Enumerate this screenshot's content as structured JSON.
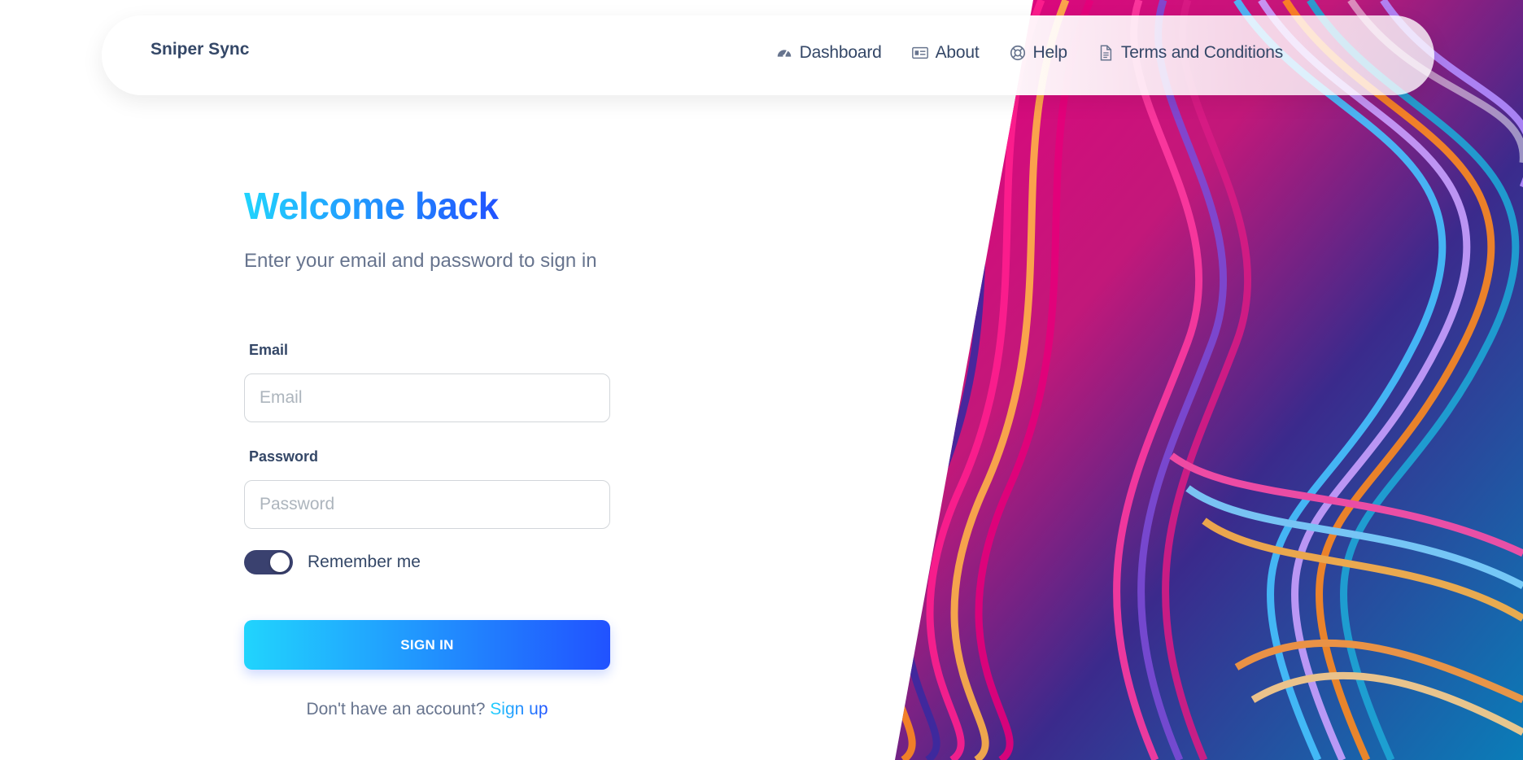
{
  "navbar": {
    "brand": "Sniper Sync",
    "items": [
      {
        "label": "Dashboard",
        "icon": "dashboard-gauge-icon"
      },
      {
        "label": "About",
        "icon": "id-card-icon"
      },
      {
        "label": "Help",
        "icon": "lifebuoy-icon"
      },
      {
        "label": "Terms and Conditions",
        "icon": "document-icon"
      }
    ]
  },
  "form": {
    "title": "Welcome back",
    "subtitle": "Enter your email and password to sign in",
    "email_label": "Email",
    "email_placeholder": "Email",
    "email_value": "",
    "password_label": "Password",
    "password_placeholder": "Password",
    "password_value": "",
    "remember_label": "Remember me",
    "remember_checked": true,
    "signin_label": "SIGN IN",
    "signup_prompt": "Don't have an account?",
    "signup_link": "Sign up"
  },
  "colors": {
    "gradient_start": "#21d4fd",
    "gradient_end": "#2152ff",
    "text_dark": "#344767",
    "text_muted": "#67748e",
    "toggle_on": "#3a416f"
  }
}
